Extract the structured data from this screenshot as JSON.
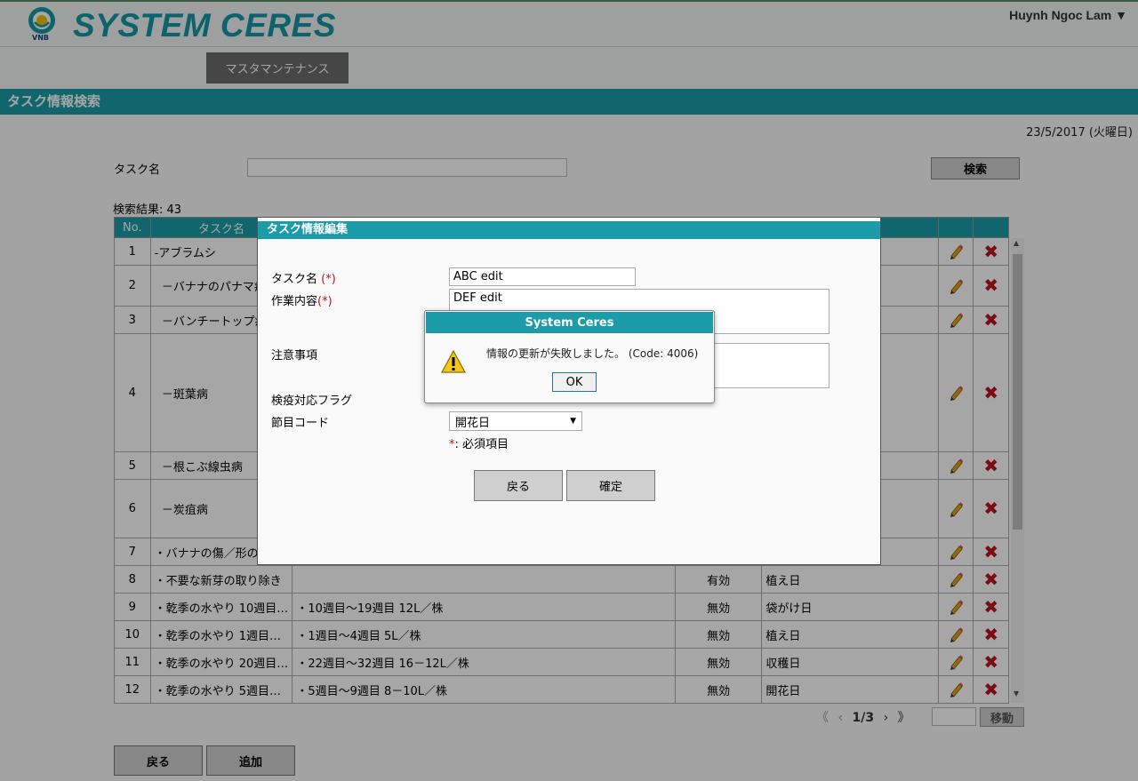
{
  "header": {
    "logo_text": "VNB",
    "app_title": "SYSTEM CERES",
    "user_menu": "Huynh Ngoc Lam ▼"
  },
  "nav": {
    "master_maintenance": "マスタマンテナンス"
  },
  "page": {
    "title": "タスク情報検索",
    "date": "23/5/2017 (火曜日)"
  },
  "search": {
    "label": "タスク名",
    "value": "",
    "button": "検索",
    "result_count": "検索結果: 43"
  },
  "table": {
    "headers": [
      "No.",
      "タスク名",
      "",
      "",
      "",
      "",
      ""
    ],
    "rows": [
      {
        "no": "1",
        "name": "-アブラムシ",
        "content": "",
        "status": "",
        "code": ""
      },
      {
        "no": "2",
        "name": "  －バナナのパナマ病",
        "content": "",
        "status": "",
        "code": ""
      },
      {
        "no": "3",
        "name": "  －バンチートップ病",
        "content": "",
        "status": "",
        "code": ""
      },
      {
        "no": "4",
        "name": "  －斑葉病",
        "content": "",
        "status": "",
        "code": ""
      },
      {
        "no": "5",
        "name": "  －根こぶ線虫病",
        "content": "",
        "status": "",
        "code": ""
      },
      {
        "no": "6",
        "name": "  －炭疽病",
        "content": "",
        "status": "",
        "code": ""
      },
      {
        "no": "7",
        "name": "・バナナの傷／形の",
        "content": "",
        "status": "",
        "code": ""
      },
      {
        "no": "8",
        "name": "・不要な新芽の取り除き",
        "content": "",
        "status": "有効",
        "code": "植え日"
      },
      {
        "no": "9",
        "name": "・乾季の水やり 10週目…",
        "content": "・10週目〜19週目 12L／株",
        "status": "無効",
        "code": "袋がけ日"
      },
      {
        "no": "10",
        "name": "・乾季の水やり 1週目…",
        "content": "・1週目〜4週目 5L／株",
        "status": "無効",
        "code": "植え日"
      },
      {
        "no": "11",
        "name": "・乾季の水やり 20週目…",
        "content": "・22週目〜32週目 16－12L／株",
        "status": "無効",
        "code": "収穫日"
      },
      {
        "no": "12",
        "name": "・乾季の水やり 5週目…",
        "content": "・5週目〜9週目 8－10L／株",
        "status": "無効",
        "code": "開花日"
      }
    ]
  },
  "pager": {
    "first": "《",
    "prev": "‹",
    "current": "1/3",
    "next": "›",
    "last": "》",
    "move": "移動"
  },
  "bottom": {
    "back": "戻る",
    "add": "追加"
  },
  "edit_modal": {
    "title": "タスク情報編集",
    "task_name_label": "タスク名 ",
    "task_name_value": "ABC edit",
    "work_label": "作業内容",
    "work_value": "DEF edit",
    "notes_label": "注意事項",
    "quarantine_label": "検疫対応フラグ",
    "season_label": "節目コード",
    "season_value": "開花日",
    "required_marker": "(*)",
    "required_star": "*",
    "required_text": ": 必須項目",
    "back": "戻る",
    "confirm": "確定"
  },
  "alert": {
    "title": "System Ceres",
    "message": "情報の更新が失敗しました。 (Code: 4006)",
    "ok": "OK",
    "icon": "warning-icon"
  },
  "colors": {
    "accent": "#1b9ca8",
    "delete": "#c0111b",
    "pencil": "#e0a020"
  }
}
